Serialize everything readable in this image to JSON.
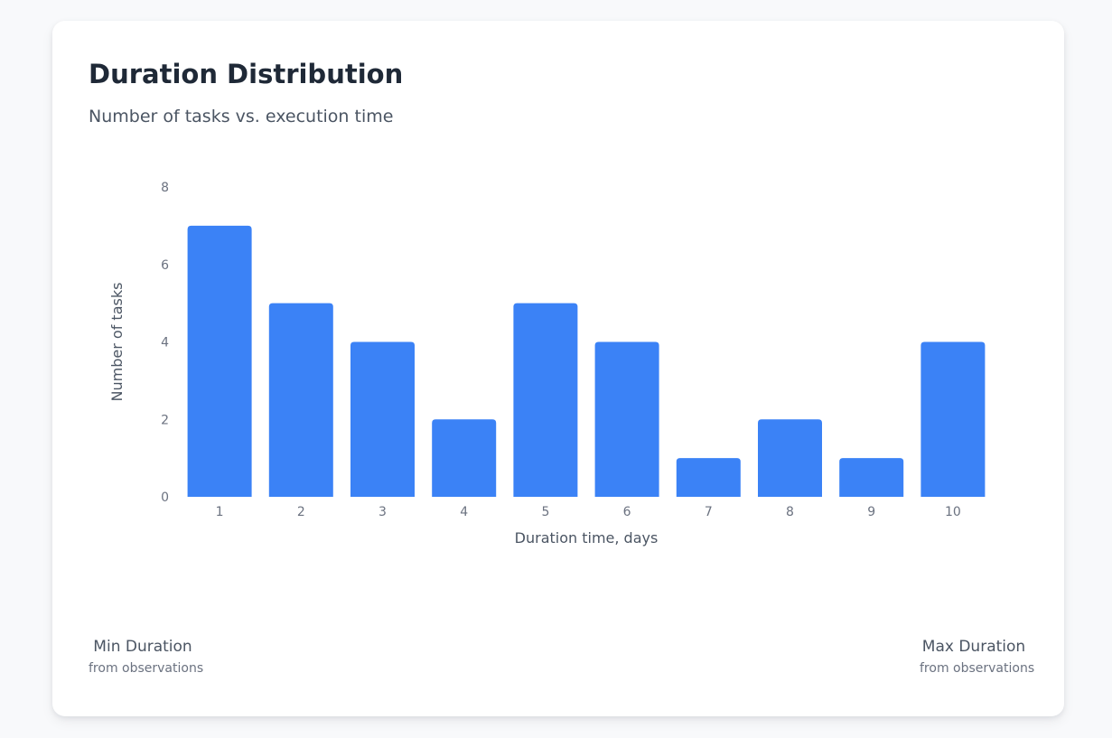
{
  "card": {
    "title": "Duration Distribution",
    "subtitle": "Number of tasks vs. execution time"
  },
  "chart_data": {
    "type": "bar",
    "categories": [
      "1",
      "2",
      "3",
      "4",
      "5",
      "6",
      "7",
      "8",
      "9",
      "10"
    ],
    "values": [
      7,
      5,
      4,
      2,
      5,
      4,
      1,
      2,
      1,
      4
    ],
    "xlabel": "Duration time, days",
    "ylabel": "Number of tasks",
    "ylim": [
      0,
      8
    ],
    "yticks": [
      0,
      2,
      4,
      6,
      8
    ],
    "grid": false,
    "bar_color": "#3b82f6"
  },
  "stats": {
    "min": {
      "label": "Min Duration",
      "sub": "from observations"
    },
    "max": {
      "label": "Max Duration",
      "sub": "from observations"
    }
  }
}
